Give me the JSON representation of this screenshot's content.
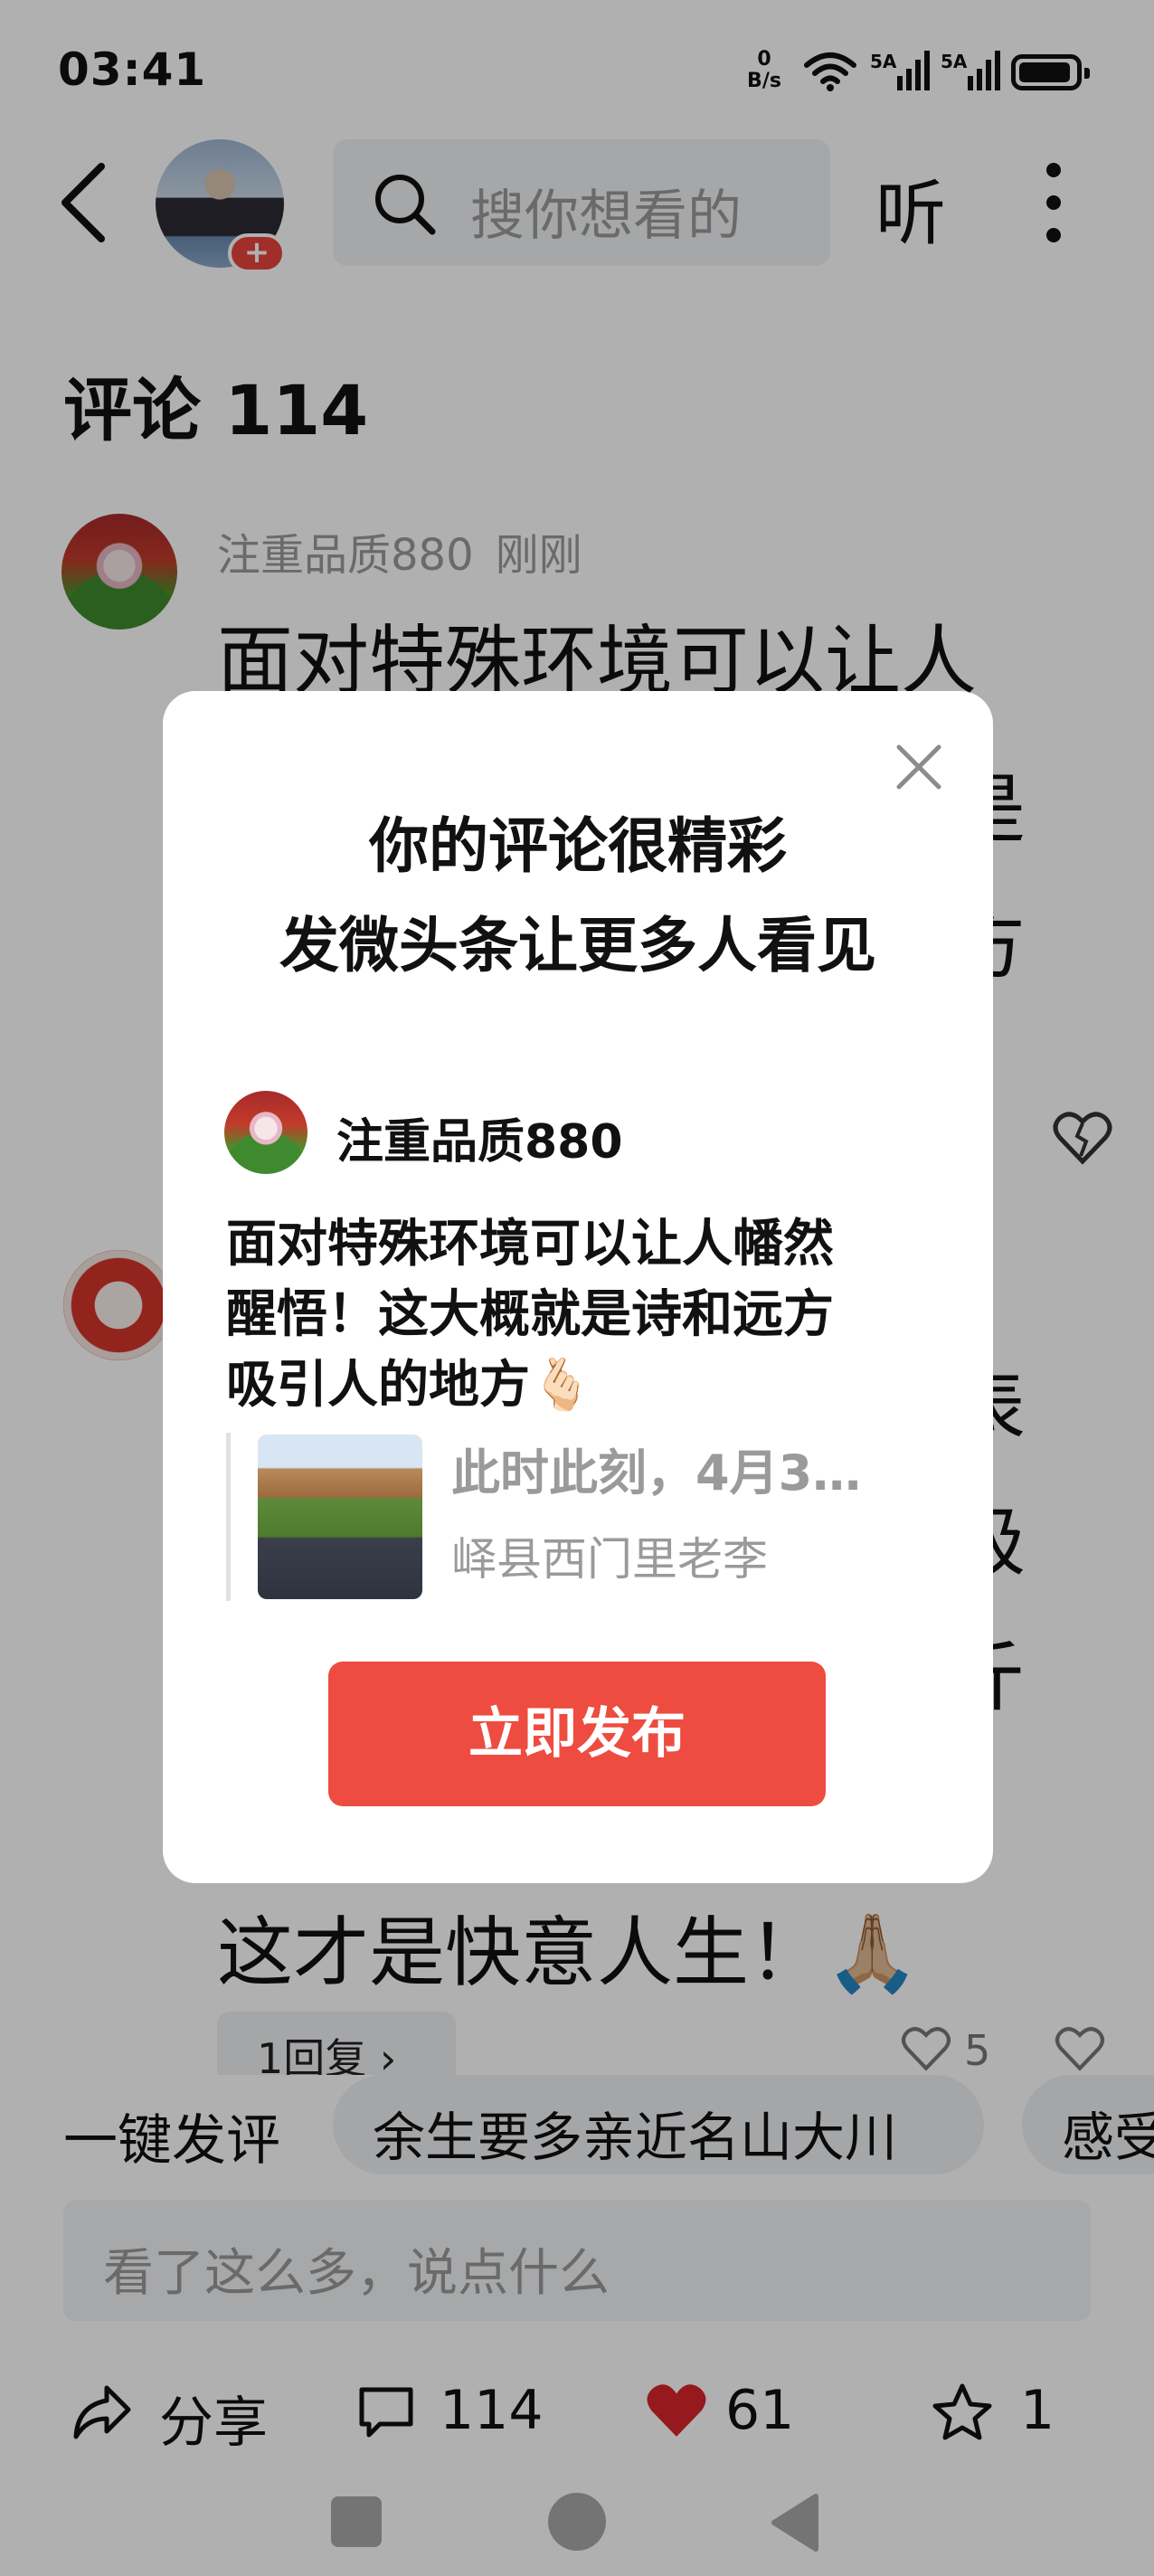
{
  "status_bar": {
    "time": "03:41",
    "network_speed_value": "0",
    "network_speed_unit": "B/s",
    "signal_1_label": "5A",
    "signal_2_label": "5A"
  },
  "top_nav": {
    "search_placeholder": "搜你想看的",
    "listen_label": "听",
    "avatar_badge": "+"
  },
  "comments": {
    "title": "评论 114",
    "first": {
      "username": "注重品质880",
      "time": "刚刚",
      "lines": [
        "面对特殊环境可以让人",
        "是",
        "方"
      ]
    },
    "second": {
      "visible_chars": [
        "表",
        "极",
        "斤"
      ],
      "last_line": "这才是快意人生！🙏🏼",
      "reply": "1回复 ›",
      "likes": "5"
    }
  },
  "quick_comments": {
    "label": "一键发评",
    "chips": [
      "余生要多亲近名山大川",
      "感受"
    ]
  },
  "input": {
    "placeholder": "看了这么多，说点什么"
  },
  "actions": {
    "share": "分享",
    "comments": "114",
    "likes": "61",
    "favorites": "1"
  },
  "modal": {
    "title_line1": "你的评论很精彩",
    "title_line2": "发微头条让更多人看见",
    "username": "注重品质880",
    "comment_lines": [
      "面对特殊环境可以让人幡然",
      "醒悟！这大概就是诗和远方",
      "吸引人的地方🫰🏻"
    ],
    "quote_title": "此时此刻，4月3…",
    "quote_author": "峄县西门里老李",
    "publish_button": "立即发布"
  },
  "colors": {
    "accent_red": "#ee4c40",
    "heart_red": "#d8252b",
    "overlay": "rgba(0,0,0,0.31)"
  }
}
